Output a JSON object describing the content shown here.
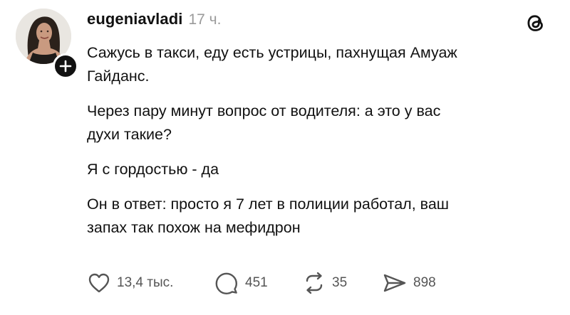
{
  "post": {
    "author": {
      "username": "eugeniavladi",
      "avatar_icon": "profile-photo"
    },
    "timestamp": "17 ч.",
    "app_logo_icon": "threads-logo-icon",
    "paragraphs": [
      {
        "lines": [
          "Сажусь в такси, еду есть устрицы, пахнущая Амуаж",
          "Гайданс."
        ]
      },
      {
        "lines": [
          "Через пару минут вопрос от водителя: а это у вас",
          "духи такие?"
        ]
      },
      {
        "lines": [
          "Я с гордостью - да"
        ]
      },
      {
        "lines": [
          "Он в ответ: просто я 7 лет в полиции работал, ваш",
          "запах так похож на мефидрон"
        ]
      }
    ],
    "actions": {
      "likes": "13,4 тыс.",
      "replies": "451",
      "reposts": "35",
      "shares": "898"
    }
  },
  "colors": {
    "text": "#111111",
    "muted": "#9a9a9a",
    "icon": "#555555",
    "badge": "#111111"
  }
}
